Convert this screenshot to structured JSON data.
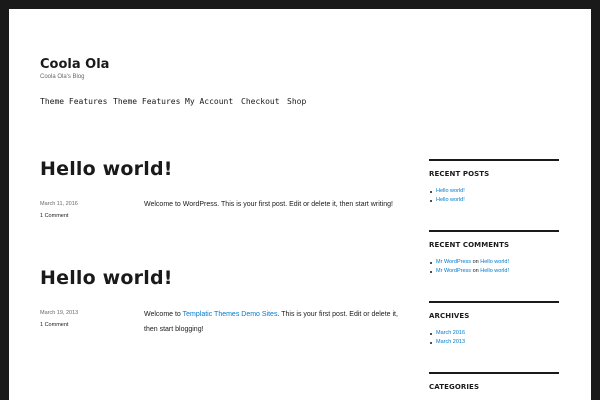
{
  "site": {
    "title": "Coola Ola",
    "description": "Coola Ola's Blog"
  },
  "nav": [
    {
      "label": "Theme Features"
    },
    {
      "label": "Theme Features"
    },
    {
      "label": "My Account"
    },
    {
      "label": "Checkout"
    },
    {
      "label": "Shop"
    }
  ],
  "posts": [
    {
      "title": "Hello world!",
      "date": "March 11, 2016",
      "comments": "1 Comment",
      "body": "Welcome to WordPress. This is your first post. Edit or delete it, then start writing!"
    },
    {
      "title": "Hello world!",
      "date": "March 19, 2013",
      "comments": "1 Comment",
      "body_pre": "Welcome to ",
      "body_link": "Templatic Themes Demo Sites",
      "body_post": ". This is your first post. Edit or delete it, then start blogging!"
    }
  ],
  "sidebar": {
    "recent_posts": {
      "title": "RECENT POSTS",
      "items": [
        "Hello world!",
        "Hello world!"
      ]
    },
    "recent_comments": {
      "title": "RECENT COMMENTS",
      "items": [
        {
          "author": "Mr WordPress",
          "on": "on",
          "post": "Hello world!"
        },
        {
          "author": "Mr WordPress",
          "on": "on",
          "post": "Hello world!"
        }
      ]
    },
    "archives": {
      "title": "ARCHIVES",
      "items": [
        "March 2016",
        "March 2013"
      ]
    },
    "categories": {
      "title": "CATEGORIES"
    }
  },
  "colors": {
    "link": "#007acc",
    "text": "#1a1a1a",
    "frame": "#1a1a1a"
  }
}
